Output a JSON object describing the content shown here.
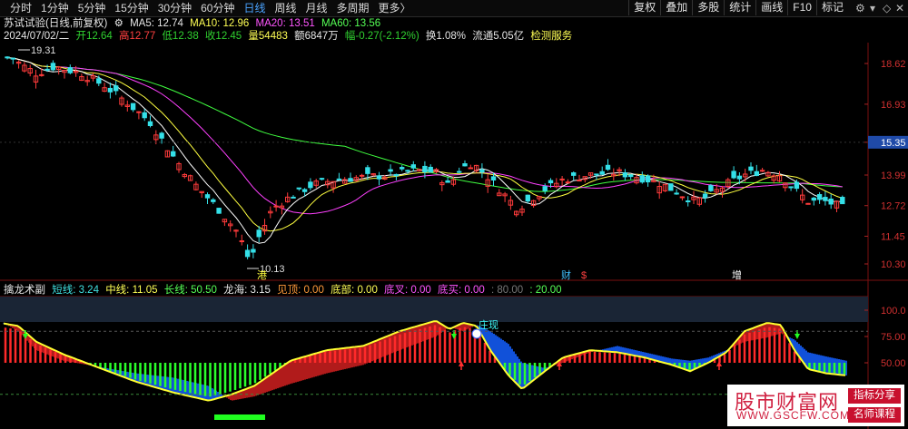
{
  "toolbar": {
    "periods": [
      "分时",
      "1分钟",
      "5分钟",
      "15分钟",
      "30分钟",
      "60分钟",
      "日线",
      "周线",
      "月线",
      "多周期",
      "更多"
    ],
    "active_period": "日线",
    "more_arrow": "〉",
    "right_buttons": [
      "复权",
      "叠加",
      "多股",
      "统计",
      "画线",
      "F10",
      "标记"
    ],
    "icons": [
      "settings-icon",
      "dropdown-icon",
      "diamond-icon",
      "close-icon"
    ]
  },
  "main_header": {
    "title": "苏试试验(日线,前复权)",
    "ma5": "MA5: 12.74",
    "ma10": "MA10: 12.96",
    "ma20": "MA20: 13.51",
    "ma60": "MA60: 13.56",
    "date": "2024/07/02/二",
    "open": "开12.64",
    "high": "高12.77",
    "low": "低12.38",
    "close": "收12.45",
    "vol": "量54483",
    "amount": "额6847万",
    "change": "幅-0.27(-2.12%)",
    "turnover": "换1.08%",
    "float": "流通5.05亿",
    "service": "检测服务"
  },
  "price_axis": {
    "ticks": [
      "18.62",
      "16.93",
      "15.35",
      "13.99",
      "12.72",
      "11.45",
      "10.30"
    ],
    "highlight": "15.35",
    "high_mark": "19.31",
    "low_mark": "10.13"
  },
  "event_marks": [
    {
      "label": "港",
      "color": "#ffff40"
    },
    {
      "label": "财",
      "color": "#40c0ff"
    },
    {
      "label": "$",
      "color": "#ff4040"
    },
    {
      "label": "增",
      "color": "#ffffff"
    }
  ],
  "sub_header": {
    "name": "擒龙术副",
    "short": "短线: 3.24",
    "mid": "中线: 11.05",
    "long": "长线: 50.50",
    "dragon": "龙海: 3.15",
    "top": "见顶: 0.00",
    "bottom": "底部: 0.00",
    "bottom_cross": "底叉: 0.00",
    "bottom_buy": "底买: 0.00",
    "v80": ": 80.00",
    "v20": ": 20.00"
  },
  "sub_axis": {
    "ticks": [
      "100.0",
      "75.00",
      "50.00"
    ]
  },
  "signal_label": "庄现",
  "watermark": {
    "site": "股市财富网",
    "url": "WWW.GSCFW.COM",
    "badge1": "指标分享",
    "badge2": "名师课程"
  },
  "colors": {
    "up": "#ff3b3b",
    "down": "#34e0e8",
    "ma5": "#ffffff",
    "ma10": "#ffff40",
    "ma20": "#ff40ff",
    "ma60": "#40ff40"
  }
}
